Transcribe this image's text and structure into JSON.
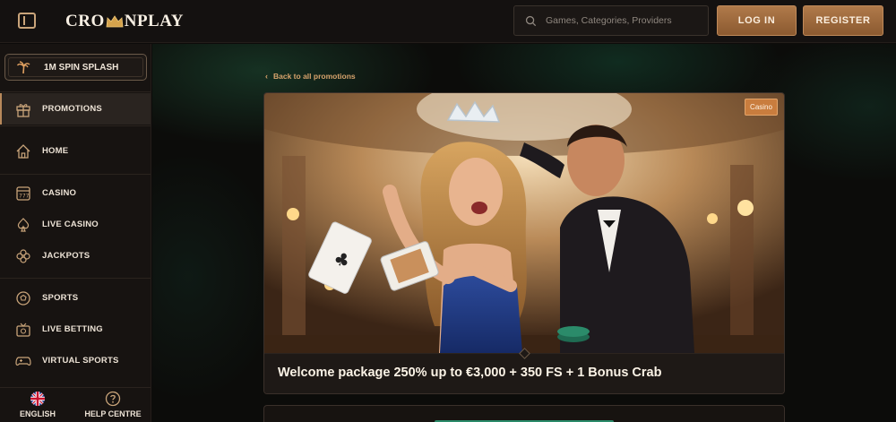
{
  "header": {
    "logo_left": "CRO",
    "logo_right": "NPLAY",
    "search_placeholder": "Games, Categories, Providers",
    "login_label": "LOG IN",
    "register_label": "REGISTER"
  },
  "sidebar": {
    "promo_pill_label": "1M SPIN SPLASH",
    "items": [
      {
        "label": "PROMOTIONS",
        "icon": "gift-icon",
        "active": true
      },
      {
        "label": "HOME",
        "icon": "home-icon"
      },
      {
        "label": "CASINO",
        "icon": "slot-machine-icon"
      },
      {
        "label": "LIVE CASINO",
        "icon": "spade-icon"
      },
      {
        "label": "JACKPOTS",
        "icon": "clover-icon"
      },
      {
        "label": "SPORTS",
        "icon": "soccer-ball-icon"
      },
      {
        "label": "LIVE BETTING",
        "icon": "live-betting-icon"
      },
      {
        "label": "VIRTUAL SPORTS",
        "icon": "gamepad-icon"
      }
    ],
    "language_label": "ENGLISH",
    "help_label": "HELP CENTRE"
  },
  "main": {
    "back_link": "Back to all promotions",
    "promotion": {
      "category_badge": "Casino",
      "title": "Welcome package 250% up to €3,000 + 350 FS + 1 Bonus Crab"
    }
  },
  "colors": {
    "accent": "#b07a4a",
    "badge": "#c97d3e",
    "back_link": "#d7a36c",
    "background": "#0d0b0a"
  }
}
